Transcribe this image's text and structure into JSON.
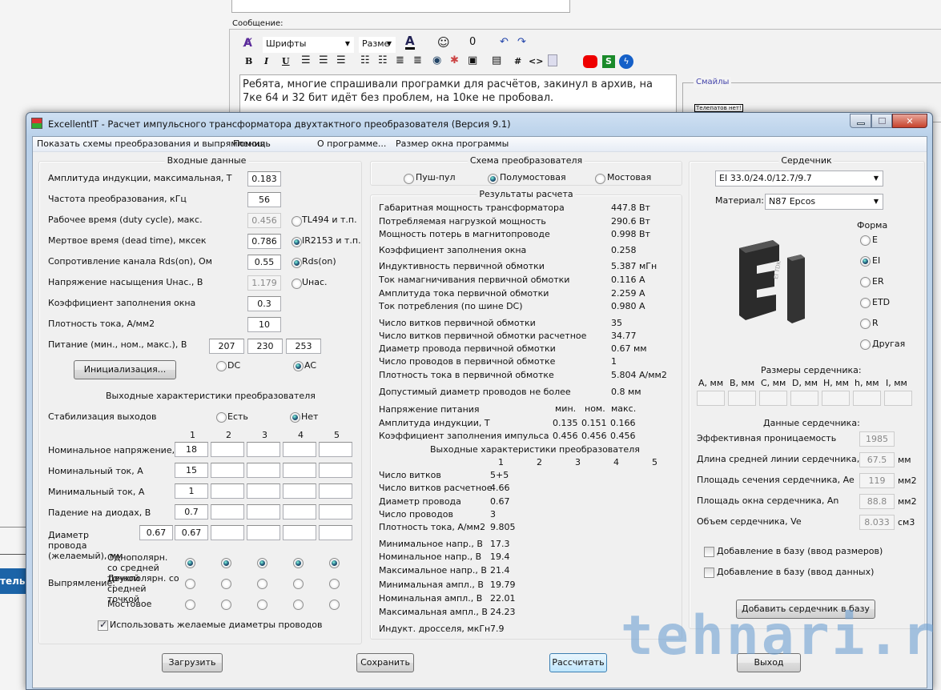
{
  "forum": {
    "message_label": "Сообщение:",
    "font_select": "Шрифты",
    "size_select": "Разме",
    "toolbar_icons": [
      "clear-format-icon",
      "font-color-icon",
      "smiley-icon",
      "attach-icon",
      "undo-icon",
      "redo-icon",
      "bold-icon",
      "italic-icon",
      "underline-icon",
      "align-left-icon",
      "align-center-icon",
      "align-right-icon",
      "ordered-list-icon",
      "unordered-list-icon",
      "outdent-icon",
      "indent-icon",
      "link-icon",
      "unlink-icon",
      "image-icon",
      "quote-icon",
      "hash-icon",
      "code-icon",
      "php-icon",
      "youtube-icon",
      "s-icon",
      "flash-icon"
    ],
    "bold": "B",
    "italic": "I",
    "underline": "U",
    "hash": "#",
    "code": "<>",
    "message_text": "Ребята, многие спрашивали програмки для расчётов, закинул в архив, на 7ке 64 и 32 бит идёт без проблем, на 10ке не пробовал.",
    "smiles_legend": "Смайлы",
    "smile_sign": "Телепатов нет!",
    "side_button": "тель"
  },
  "window": {
    "title": "ExcellentIT - Расчет импульсного трансформатора двухтактного преобразователя (Версия 9.1)",
    "menu": [
      "Показать схемы преобразования и выпрямления",
      "Помощь",
      "О программе...",
      "Размер окна программы"
    ]
  },
  "input": {
    "title": "Входные данные",
    "rows": [
      {
        "label": "Амплитуда индукции, максимальная, Т",
        "value": "0.183"
      },
      {
        "label": "Частота преобразования, кГц",
        "value": "56"
      },
      {
        "label": "Рабочее время (duty cycle), макс.",
        "value": "0.456",
        "disabled": true,
        "radio": "TL494 и т.п.",
        "checked": false
      },
      {
        "label": "Мертвое время (dead time), мксек",
        "value": "0.786",
        "radio": "IR2153 и т.п.",
        "checked": true
      },
      {
        "label": "Сопротивление канала Rds(on), Ом",
        "value": "0.55",
        "radio": "Rds(on)",
        "checked": true
      },
      {
        "label": "Напряжение насыщения Uнас., В",
        "value": "1.179",
        "disabled": true,
        "radio": "Uнас.",
        "checked": false
      },
      {
        "label": "Коэффициент заполнения окна",
        "value": "0.3"
      },
      {
        "label": "Плотность тока, А/мм2",
        "value": "10"
      }
    ],
    "supply_label": "Питание (мин., ном., макс.), В",
    "supply": [
      "207",
      "230",
      "253"
    ],
    "init_button": "Инициализация...",
    "dc": "DC",
    "ac": "AC",
    "ac_selected": true
  },
  "output": {
    "title": "Выходные характеристики преобразователя",
    "stab_label": "Стабилизация выходов",
    "stab_yes": "Есть",
    "stab_no": "Нет",
    "stab_selected": "Нет",
    "columns": [
      "1",
      "2",
      "3",
      "4",
      "5"
    ],
    "rows": [
      {
        "label": "Номинальное напряжение, В",
        "values": [
          "18",
          "",
          "",
          "",
          ""
        ]
      },
      {
        "label": "Номинальный ток, А",
        "values": [
          "15",
          "",
          "",
          "",
          ""
        ]
      },
      {
        "label": "Минимальный ток, А",
        "values": [
          "1",
          "",
          "",
          "",
          ""
        ]
      },
      {
        "label": "Падение на диодах, В",
        "values": [
          "0.7",
          "",
          "",
          "",
          ""
        ]
      },
      {
        "label": "Диаметр провода (желаемый), мм",
        "values": [
          "0.67",
          "",
          "",
          "",
          ""
        ],
        "extra": "0.67"
      }
    ],
    "rect_label": "Выпрямление:",
    "rect_options": [
      "Однополярн. со средней точкой",
      "Двухполярн. со средней точкой",
      "Мостовое"
    ],
    "rect_selected": 0,
    "use_desired": "Использовать желаемые диаметры проводов",
    "use_desired_checked": true
  },
  "scheme": {
    "title": "Схема преобразователя",
    "options": [
      "Пуш-пул",
      "Полумостовая",
      "Мостовая"
    ],
    "selected": 1
  },
  "results": {
    "title": "Результаты расчета",
    "rows": [
      {
        "label": "Габаритная мощность трансформатора",
        "value": "447.8 Вт"
      },
      {
        "label": "Потребляемая нагрузкой мощность",
        "value": "290.6 Вт"
      },
      {
        "label": "Мощность потерь в магнитопроводе",
        "value": "0.998 Вт"
      },
      {
        "label": "Коэффициент заполнения окна",
        "value": "0.258"
      },
      {
        "label": "Индуктивность первичной обмотки",
        "value": "5.387 мГн"
      },
      {
        "label": "Ток намагничивания первичной обмотки",
        "value": "0.116 А"
      },
      {
        "label": "Амплитуда тока первичной обмотки",
        "value": "2.259 А"
      },
      {
        "label": "Ток потребления (по шине DC)",
        "value": "0.980 А"
      },
      {
        "label": "Число витков первичной обмотки",
        "value": "35"
      },
      {
        "label": "Число витков первичной обмотки расчетное",
        "value": "34.77"
      },
      {
        "label": "Диаметр провода первичной обмотки",
        "value": "0.67 мм"
      },
      {
        "label": "Число проводов в первичной обмотке",
        "value": "1"
      },
      {
        "label": "Плотность тока в первичной обмотке",
        "value": "5.804 А/мм2"
      },
      {
        "label": "Допустимый диаметр проводов не более",
        "value": "0.8 мм"
      }
    ],
    "supply_header": {
      "label": "Напряжение питания",
      "cols": [
        "мин.",
        "ном.",
        "макс."
      ]
    },
    "supply_rows": [
      {
        "label": "Амплитуда индукции, Т",
        "values": [
          "0.135",
          "0.151",
          "0.166"
        ]
      },
      {
        "label": "Коэффициент заполнения импульса",
        "values": [
          "0.456",
          "0.456",
          "0.456"
        ]
      }
    ],
    "out_title": "Выходные характеристики преобразователя",
    "out_columns": [
      "1",
      "2",
      "3",
      "4",
      "5"
    ],
    "out_rows": [
      {
        "label": "Число витков",
        "value": "5+5"
      },
      {
        "label": "Число витков расчетное",
        "value": "4.66"
      },
      {
        "label": "Диаметр провода",
        "value": "0.67"
      },
      {
        "label": "Число проводов",
        "value": "3"
      },
      {
        "label": "Плотность тока, А/мм2",
        "value": "9.805"
      },
      {
        "label": "Минимальное напр., В",
        "value": "17.3"
      },
      {
        "label": "Номинальное напр., В",
        "value": "19.4"
      },
      {
        "label": "Максимальное напр., В",
        "value": "21.4"
      },
      {
        "label": "Минимальная ампл., В",
        "value": "19.79"
      },
      {
        "label": "Номинальная ампл., В",
        "value": "22.01"
      },
      {
        "label": "Максимальная ампл., В",
        "value": "24.23"
      },
      {
        "label": "Индукт. дросселя, мкГн",
        "value": "7.9"
      }
    ]
  },
  "core": {
    "title": "Сердечник",
    "core_select": "EI 33.0/24.0/12.7/9.7",
    "material_label": "Материал:",
    "material_select": "N87 Epcos",
    "shape_title": "Форма",
    "shapes": [
      "E",
      "EI",
      "ER",
      "ETD",
      "R",
      "Другая"
    ],
    "shape_selected": 1,
    "image_lettering": "EI TDK",
    "sizes_title": "Размеры сердечника:",
    "sizes": [
      "A, мм",
      "B, мм",
      "C, мм",
      "D, мм",
      "H, мм",
      "h, мм",
      "I, мм"
    ],
    "data_title": "Данные сердечника:",
    "data_rows": [
      {
        "label": "Эффективная проницаемость",
        "value": "1985",
        "unit": ""
      },
      {
        "label": "Длина средней линии сердечника, le",
        "value": "67.5",
        "unit": "мм"
      },
      {
        "label": "Площадь сечения сердечника, Ae",
        "value": "119",
        "unit": "мм2"
      },
      {
        "label": "Площадь окна сердечника, An",
        "value": "88.8",
        "unit": "мм2"
      },
      {
        "label": "Объем сердечника, Ve",
        "value": "8.033",
        "unit": "см3"
      }
    ],
    "add_sizes": "Добавление в базу (ввод размеров)",
    "add_data": "Добавление в базу (ввод данных)",
    "add_button": "Добавить сердечник в базу"
  },
  "buttons": {
    "load": "Загрузить",
    "save": "Сохранить",
    "calc": "Рассчитать",
    "exit": "Выход"
  },
  "watermark": "tehnari.ru"
}
